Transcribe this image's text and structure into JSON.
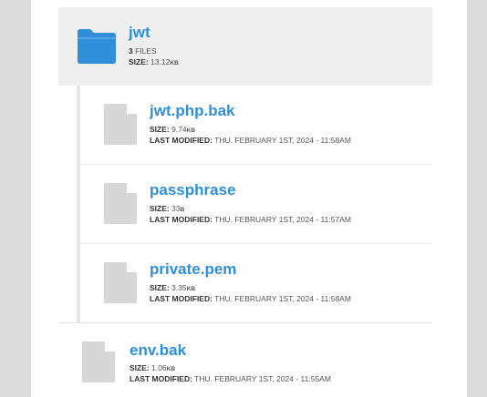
{
  "folder": {
    "name": "jwt",
    "files_count": "3",
    "files_label": "FILES",
    "size_label": "SIZE:",
    "size_value": "13.12",
    "size_unit": "KB",
    "icon": "folder-icon",
    "color": "#2f8fd8"
  },
  "labels": {
    "size": "SIZE:",
    "last_modified": "LAST MODIFIED:"
  },
  "children": [
    {
      "name": "jwt.php.bak",
      "size_value": "9.74",
      "size_unit": "KB",
      "modified": "THU. FEBRUARY 1ST, 2024 - 11:58AM",
      "icon": "file-icon"
    },
    {
      "name": "passphrase",
      "size_value": "33",
      "size_unit": "B",
      "modified": "THU. FEBRUARY 1ST, 2024 - 11:57AM",
      "icon": "file-icon"
    },
    {
      "name": "private.pem",
      "size_value": "3.35",
      "size_unit": "KB",
      "modified": "THU. FEBRUARY 1ST, 2024 - 11:58AM",
      "icon": "file-icon"
    }
  ],
  "env": {
    "name": "env.bak",
    "size_value": "1.06",
    "size_unit": "KB",
    "modified": "THU. FEBRUARY 1ST, 2024 - 11:55AM",
    "icon": "file-icon"
  }
}
